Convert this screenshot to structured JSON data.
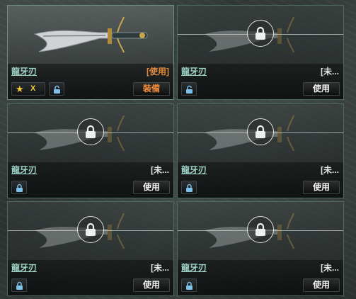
{
  "items": [
    {
      "name": "龍牙刃",
      "status": "[使用]",
      "button": "裝備",
      "grade": "X",
      "state": "equipped",
      "lock_icon": "unlocked-padlock-icon"
    },
    {
      "name": "龍牙刃",
      "status": "[未...",
      "button": "使用",
      "state": "locked",
      "lock_icon": "unlocked-padlock-icon"
    },
    {
      "name": "龍牙刃",
      "status": "[未...",
      "button": "使用",
      "state": "locked",
      "lock_icon": "padlock-icon"
    },
    {
      "name": "龍牙刃",
      "status": "[未...",
      "button": "使用",
      "state": "locked",
      "lock_icon": "padlock-icon"
    },
    {
      "name": "龍牙刃",
      "status": "[未...",
      "button": "使用",
      "state": "locked",
      "lock_icon": "padlock-icon"
    },
    {
      "name": "龍牙刃",
      "status": "[未...",
      "button": "使用",
      "state": "locked",
      "lock_icon": "padlock-icon"
    }
  ],
  "colors": {
    "accent": "#e58a3d",
    "name": "#9ed3c4",
    "border": "#4b6a61",
    "star": "#f2cf3a"
  }
}
